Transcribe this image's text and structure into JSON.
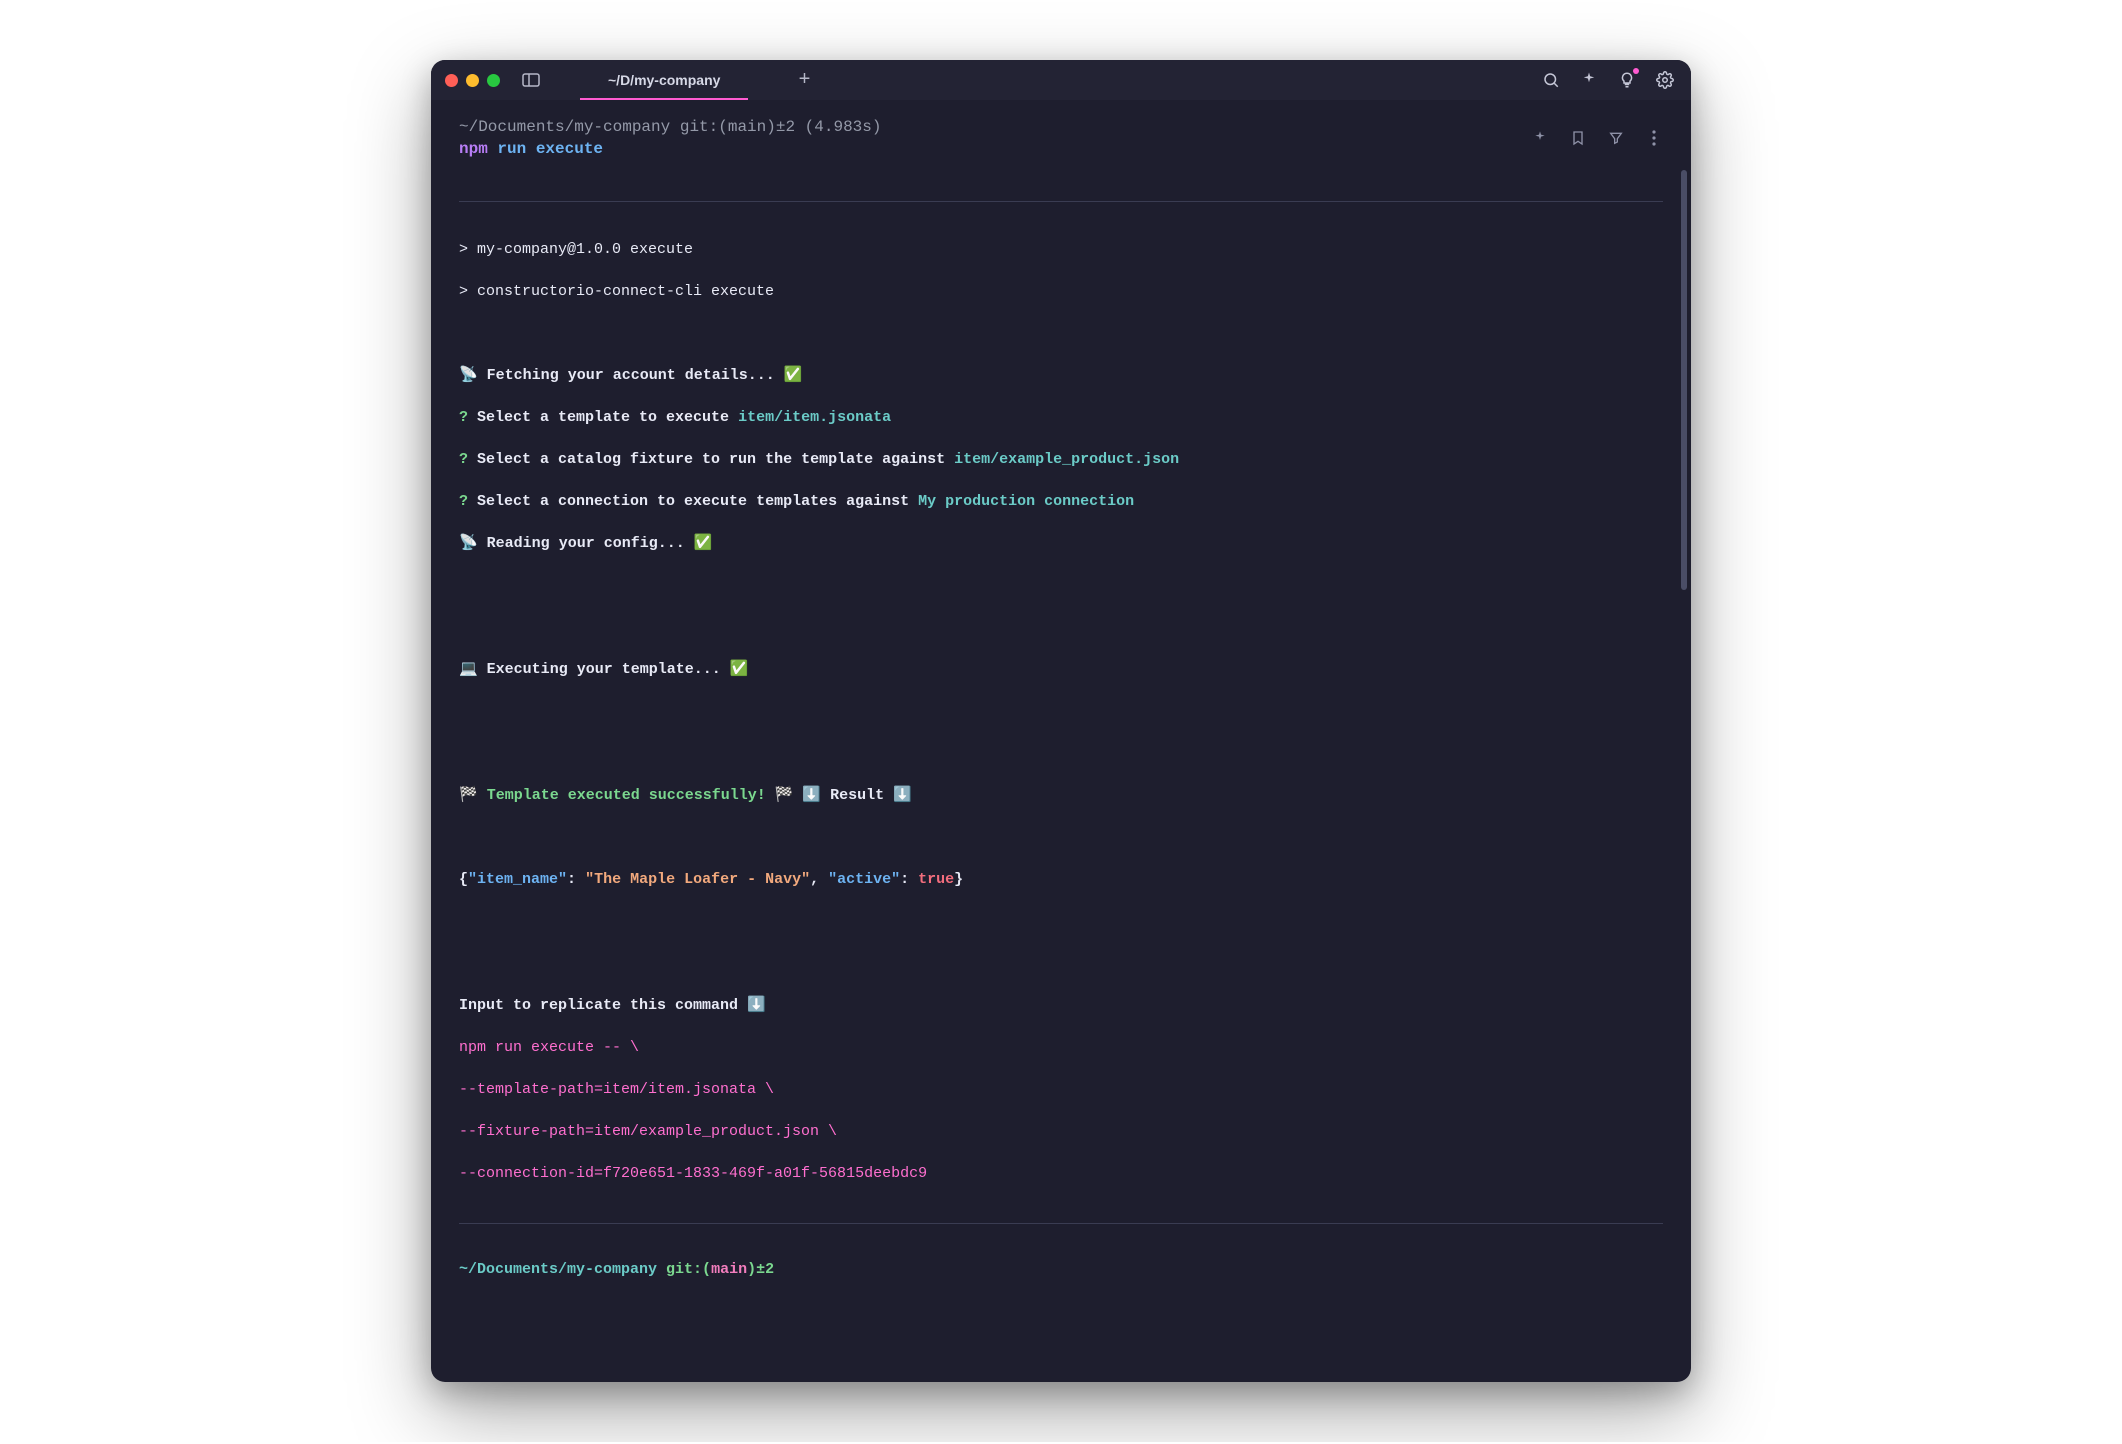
{
  "window": {
    "tab_title": "~/D/my-company"
  },
  "prompt1": {
    "path": "~/Documents/my-company",
    "git_prefix": " git:(",
    "git_branch": "main",
    "git_suffix": ")±2",
    "timing": " (4.983s)"
  },
  "cmd1": {
    "npm": "npm ",
    "run": "run ",
    "execute": "execute"
  },
  "out1": "> my-company@1.0.0 execute",
  "out2": "> constructorio-connect-cli execute",
  "fetch_line": "📡 Fetching your account details... ✅",
  "q1": {
    "q": "?",
    "text": " Select a template to execute ",
    "answer": "item/item.jsonata"
  },
  "q2": {
    "q": "?",
    "text": " Select a catalog fixture to run the template against ",
    "answer": "item/example_product.json"
  },
  "q3": {
    "q": "?",
    "text": " Select a connection to execute templates against ",
    "answer": "My production connection"
  },
  "read_config": "📡 Reading your config... ✅",
  "exec_line": "💻 Executing your template... ✅",
  "success": {
    "flag1": "🏁 ",
    "text": "Template executed successfully!",
    "flag2": " 🏁 ⬇️ ",
    "result": "Result",
    "arrow": " ⬇️"
  },
  "json_out": {
    "open": "{",
    "k1": "\"item_name\"",
    "c1": ": ",
    "v1": "\"The Maple Loafer - Navy\"",
    "sep": ", ",
    "k2": "\"active\"",
    "c2": ": ",
    "v2": "true",
    "close": "}"
  },
  "replicate_header": "Input to replicate this command ⬇️",
  "replicate_lines": [
    "npm run execute -- \\",
    "--template-path=item/item.jsonata \\",
    "--fixture-path=item/example_product.json \\",
    "--connection-id=f720e651-1833-469f-a01f-56815deebdc9"
  ],
  "prompt2": {
    "path": "~/Documents/my-company",
    "git_prefix": " git:(",
    "git_branch": "main",
    "git_suffix": ")±2"
  }
}
